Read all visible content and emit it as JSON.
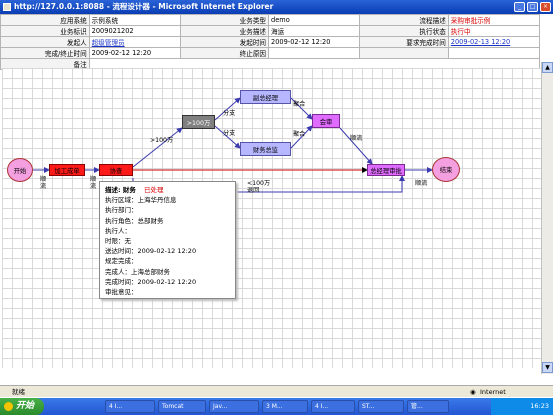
{
  "window": {
    "title": "http://127.0.0.1:8088 - 流程设计器 - Microsoft Internet Explorer"
  },
  "info": {
    "rows": [
      [
        {
          "l": "应用系统",
          "v": "示例系统"
        },
        {
          "l": "业务类型",
          "v": "demo"
        },
        {
          "l": "流程描述",
          "v": "采购审批示例",
          "c": "red"
        }
      ],
      [
        {
          "l": "业务标识",
          "v": "2009021202"
        },
        {
          "l": "业务描述",
          "v": "海运"
        },
        {
          "l": "执行状态",
          "v": "执行中",
          "c": "red"
        }
      ],
      [
        {
          "l": "发起人",
          "v": "超级管理员",
          "c": "link"
        },
        {
          "l": "发起时间",
          "v": "2009-02-12 12:20"
        },
        {
          "l": "要求完成时间",
          "v": "2009-02-13 12:20",
          "c": "link"
        }
      ],
      [
        {
          "l": "完成/终止时间",
          "v": "2009-02-12 12:20"
        },
        {
          "l": "终止原因",
          "v": ""
        },
        {
          "l": "",
          "v": ""
        }
      ],
      [
        {
          "l": "备注",
          "v": ""
        }
      ]
    ]
  },
  "flow": {
    "start": "开始",
    "n1": "加工成单",
    "n2": "协查",
    "gate": ">100万",
    "deputy": "副总经理",
    "cfo": "财务总监",
    "audit": "会审",
    "gm": "总经理审批",
    "end": "结束",
    "l_seq1": "顺流",
    "l_seq2": "顺流",
    "l_gt100": ">100万",
    "l_branch1": "分支",
    "l_branch2": "分支",
    "l_merge1": "聚合",
    "l_merge2": "聚合",
    "l_seq3": "顺流",
    "l_lt100": "<100万",
    "l_back": "退回",
    "l_seq4": "顺流"
  },
  "popup": {
    "title": "描述: 财务",
    "status": "已处理",
    "lines": [
      "执行区域：上海华丹信息",
      "执行部门：",
      "执行角色：总部财务",
      "执行人：",
      "时限：无",
      "送达时间：2009-02-12 12:20",
      "规定完成：",
      "完成人：上海总部财务",
      "完成时间：2009-02-12 12:20",
      "审批意见："
    ]
  },
  "status": {
    "text": "就绪",
    "zone": "Internet"
  },
  "taskbar": {
    "start": "开始",
    "tasks": [
      "4 I...",
      "Tomcat",
      "Jav...",
      "3 M...",
      "4 I...",
      "ST...",
      "管..."
    ],
    "clock": "16:23"
  }
}
